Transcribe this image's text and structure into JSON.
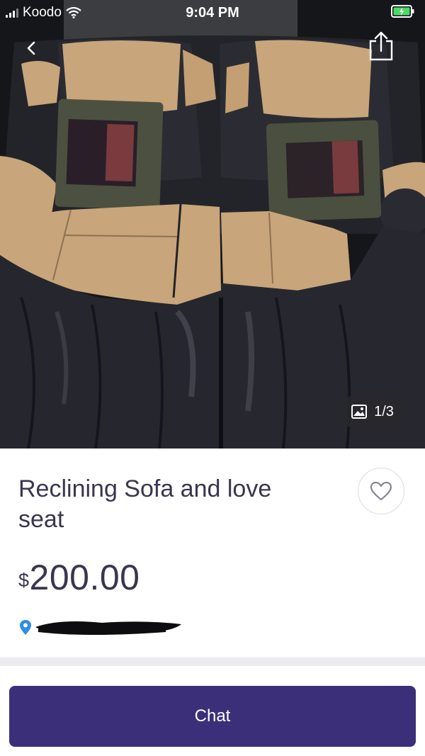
{
  "status_bar": {
    "carrier": "Koodo",
    "time": "9:04 PM"
  },
  "photo": {
    "counter": "1/3"
  },
  "listing": {
    "title": "Reclining Sofa and love seat",
    "currency_symbol": "$",
    "price": "200.00"
  },
  "actions": {
    "chat_label": "Chat"
  },
  "colors": {
    "accent": "#3b2f7a",
    "text": "#3b3550",
    "location_pin": "#2f8ee6"
  },
  "icons": [
    "chevron-left-icon",
    "share-icon",
    "image-icon",
    "heart-icon",
    "location-pin-icon",
    "wifi-icon",
    "battery-icon"
  ]
}
